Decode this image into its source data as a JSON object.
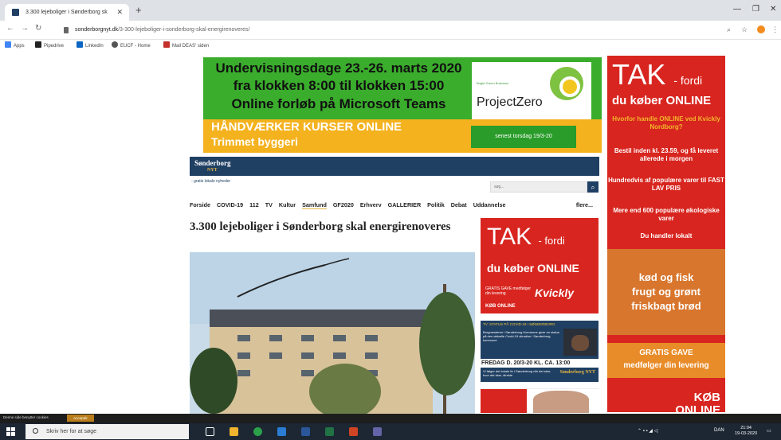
{
  "browser": {
    "tab_title": "3.300 lejeboliger i Sønderborg sk",
    "new_tab": "+",
    "url_host": "sonderborgnyt.dk",
    "url_path": "/3-300-lejeboliger-i-sonderborg-skal-energirenoveres/",
    "bookmarks": [
      "Apps",
      "Pipedrive",
      "LinkedIn",
      "EUCF - Home",
      "Mail DEAS' siden"
    ]
  },
  "ads": {
    "top_line1": "Undervisningsdage 23.-26. marts 2020",
    "top_line2": "fra klokken 8:00 til klokken 15:00",
    "top_line3": "Online forløb på Microsoft Teams",
    "pz_small": "Bright Green Business",
    "pz_name": "ProjectZero",
    "yellow_line1": "HÅNDVÆRKER KURSER ONLINE",
    "yellow_line2": "Trimmet byggeri",
    "yellow_tag": "senest torsdag 19/3-20",
    "mid_tak": "TAK",
    "mid_fordi": "- fordi",
    "mid_online": "du køber ONLINE",
    "mid_gratis": "GRATIS GAVE medfølger din levering",
    "mid_kvickly": "Kvickly",
    "mid_kob": "KØB ONLINE",
    "tv_head": "TV: STATUS PÅ COVID-19 I SØNDERBORG",
    "tv_body": "Borgmesteren i Sønderborg Kommune giver en status på den aktuelle Covid-19 situation i Sønderborg kommune",
    "friday": "FREDAG D. 20/3-20 KL. CA. 13:00",
    "bluebar_text": "Vi følger det lokale liv i Sønderborg når det sker, hvor det sker, direkte",
    "bluebar_logo": "Sønderborg NYT",
    "right_tak": "TAK",
    "right_fordi": "- fordi",
    "right_online": "du køber ONLINE",
    "right_q": "Hvorfor handle ONLINE ved Kvickly Nordborg?",
    "right_p1": "Bestil inden kl. 23.59, og få leveret allerede i morgen",
    "right_p2": "Hundredvis af populære varer til FAST LAV PRIS",
    "right_p3": "Mere end 600 populære økologiske varer",
    "right_p4": "Du handler lokalt",
    "veg1": "kød og fisk",
    "veg2": "frugt og grønt",
    "veg3": "friskbagt brød",
    "gratis": "GRATIS GAVE",
    "gratis2": "medfølger din levering",
    "kob": "KØB",
    "online": "ONLINE"
  },
  "site": {
    "logo": "Sønderborg",
    "logo_sub": "NYT",
    "tagline": "- gratis lokale nyheder",
    "search_placeholder": "søg...",
    "nav": [
      "Forside",
      "COVID-19",
      "112",
      "TV",
      "Kultur",
      "Samfund",
      "GF2020",
      "Erhverv",
      "GALLERIER",
      "Politik",
      "Debat",
      "Uddannelse"
    ],
    "nav_more": "flere...",
    "article_title": "3.300 lejeboliger i Sønderborg skal energirenoveres"
  },
  "cookie": {
    "text": "Denne side benytter cookies",
    "accept": "Acceptér"
  },
  "taskbar": {
    "search": "Skriv her for at søge",
    "lang": "DAN",
    "time": "21:04",
    "date": "19-03-2020"
  }
}
